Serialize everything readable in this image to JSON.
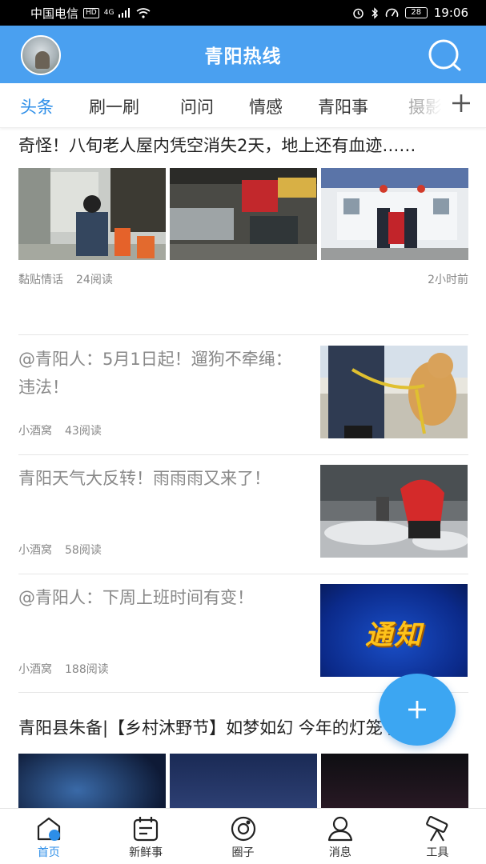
{
  "status_bar": {
    "carrier": "中国电信",
    "hd": "HD",
    "net": "4G",
    "battery": "28",
    "time": "19:06"
  },
  "header": {
    "title": "青阳热线"
  },
  "tabs": [
    "头条",
    "刷一刷",
    "问问",
    "情感",
    "青阳事",
    "摄影"
  ],
  "articles": [
    {
      "title": "奇怪！八旬老人屋内凭空消失2天，地上还有血迹……",
      "source": "黏贴情话",
      "reads": "24阅读",
      "time": "2小时前"
    },
    {
      "title": "@青阳人：5月1日起！遛狗不牵绳：违法！",
      "source": "小酒窝",
      "reads": "43阅读"
    },
    {
      "title": "青阳天气大反转！雨雨雨又来了！",
      "source": "小酒窝",
      "reads": "58阅读"
    },
    {
      "title": "@青阳人：下周上班时间有变！",
      "source": "小酒窝",
      "reads": "188阅读",
      "image_text": "通知"
    },
    {
      "title": "青阳县朱备|【乡村沐野节】如梦如幻 今年的灯笼节玩嗨了"
    }
  ],
  "fab": {
    "label": "+"
  },
  "bottom_nav": [
    {
      "label": "首页",
      "icon": "home-icon",
      "active": true
    },
    {
      "label": "新鲜事",
      "icon": "calendar-icon"
    },
    {
      "label": "圈子",
      "icon": "circle-icon"
    },
    {
      "label": "消息",
      "icon": "user-icon"
    },
    {
      "label": "工具",
      "icon": "telescope-icon"
    }
  ],
  "colors": {
    "primary": "#4aa0f0",
    "active_tab": "#2d8ee8",
    "fab": "#3ca6f2"
  }
}
